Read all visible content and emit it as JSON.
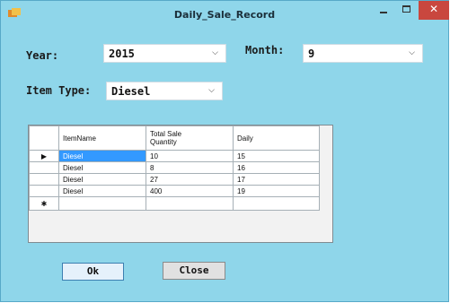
{
  "window": {
    "title": "Daily_Sale_Record",
    "close_glyph": "✕"
  },
  "form": {
    "year": {
      "label": "Year:",
      "value": "2015"
    },
    "month": {
      "label": "Month:",
      "value": "9"
    },
    "item_type": {
      "label": "Item Type:",
      "value": "Diesel"
    }
  },
  "grid": {
    "columns": [
      "ItemName",
      "Total Sale\nQuantity",
      "Daily"
    ],
    "rows": [
      {
        "marker": "▶",
        "cells": [
          "Diesel",
          "10",
          "15"
        ]
      },
      {
        "marker": "",
        "cells": [
          "Diesel",
          "8",
          "16"
        ]
      },
      {
        "marker": "",
        "cells": [
          "Diesel",
          "27",
          "17"
        ]
      },
      {
        "marker": "",
        "cells": [
          "Diesel",
          "400",
          "19"
        ]
      }
    ],
    "new_row_marker": "✱"
  },
  "buttons": {
    "ok": "Ok",
    "close": "Close"
  }
}
